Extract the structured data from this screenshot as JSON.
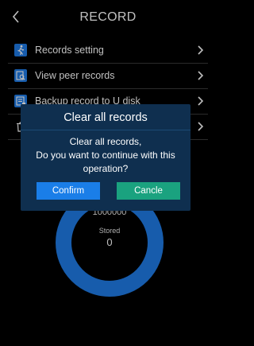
{
  "header": {
    "title": "RECORD"
  },
  "menu": {
    "items": [
      {
        "label": "Records setting",
        "icon": "walk-icon"
      },
      {
        "label": "View peer records",
        "icon": "search-record-icon"
      },
      {
        "label": "Backup record to U disk",
        "icon": "backup-icon"
      },
      {
        "label": "",
        "icon": "trash-icon"
      }
    ]
  },
  "storage": {
    "capacity": "1000000",
    "stored_label": "Stored",
    "stored_value": "0"
  },
  "dialog": {
    "title": "Clear all records",
    "message_line1": "Clear all records,",
    "message_line2": "Do you want to continue with this",
    "message_line3": "operation?",
    "confirm_label": "Confirm",
    "cancel_label": "Cancle"
  },
  "colors": {
    "accent": "#1a7ee8",
    "cancel": "#1aa27f",
    "dialog_bg": "#0f2f4f",
    "ring": "#1f7be6"
  }
}
